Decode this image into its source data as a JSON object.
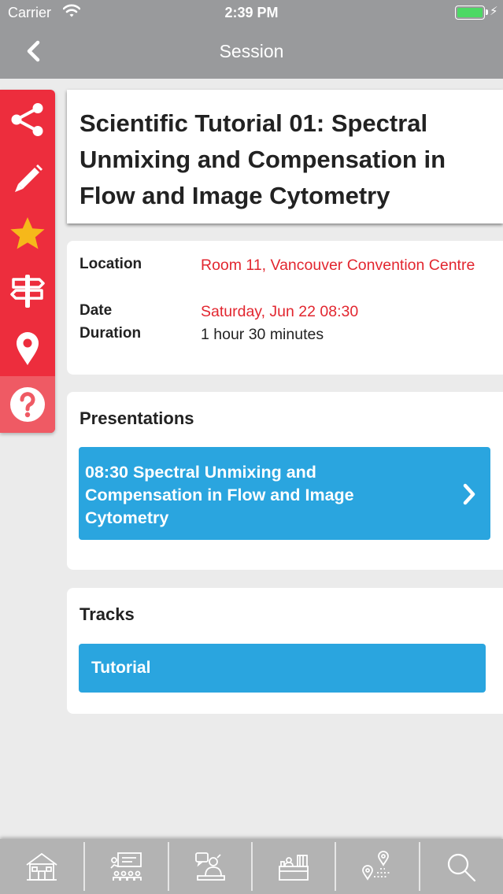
{
  "status_bar": {
    "carrier": "Carrier",
    "time": "2:39 PM"
  },
  "nav": {
    "title": "Session",
    "back_icon": "chevron-left-icon"
  },
  "rail": [
    {
      "name": "share",
      "icon": "share-icon"
    },
    {
      "name": "note",
      "icon": "pencil-icon"
    },
    {
      "name": "favorite",
      "icon": "star-icon"
    },
    {
      "name": "directions",
      "icon": "signpost-icon"
    },
    {
      "name": "location",
      "icon": "map-pin-icon"
    },
    {
      "name": "help",
      "icon": "question-icon"
    }
  ],
  "session": {
    "title": "Scientific Tutorial 01: Spectral Unmixing and Compensation in Flow and Image Cytometry"
  },
  "details": {
    "location_label": "Location",
    "location_value": "Room 11, Vancouver Convention Centre",
    "date_label": "Date",
    "date_value": "Saturday, Jun 22 08:30",
    "duration_label": "Duration",
    "duration_value": "1 hour 30 minutes"
  },
  "presentations": {
    "heading": "Presentations",
    "items": [
      {
        "time": "08:30",
        "title": "Spectral Unmixing and Compensation in Flow and Image Cytometry",
        "display": "08:30  Spectral Unmixing and Compensation in Flow and Image Cytometry"
      }
    ]
  },
  "tracks": {
    "heading": "Tracks",
    "items": [
      {
        "label": "Tutorial"
      }
    ]
  },
  "tabbar": [
    {
      "name": "home",
      "icon": "home-icon"
    },
    {
      "name": "program",
      "icon": "presentation-icon"
    },
    {
      "name": "speakers",
      "icon": "speaker-icon"
    },
    {
      "name": "exhibitors",
      "icon": "exhibitor-booth-icon"
    },
    {
      "name": "venue",
      "icon": "venue-map-icon"
    },
    {
      "name": "search",
      "icon": "search-icon"
    }
  ],
  "colors": {
    "accent_red": "#ed2d3d",
    "accent_blue": "#2aa5df",
    "value_red": "#e2262f",
    "nav_gray": "#999a9c",
    "star_yellow": "#f6b81a"
  }
}
